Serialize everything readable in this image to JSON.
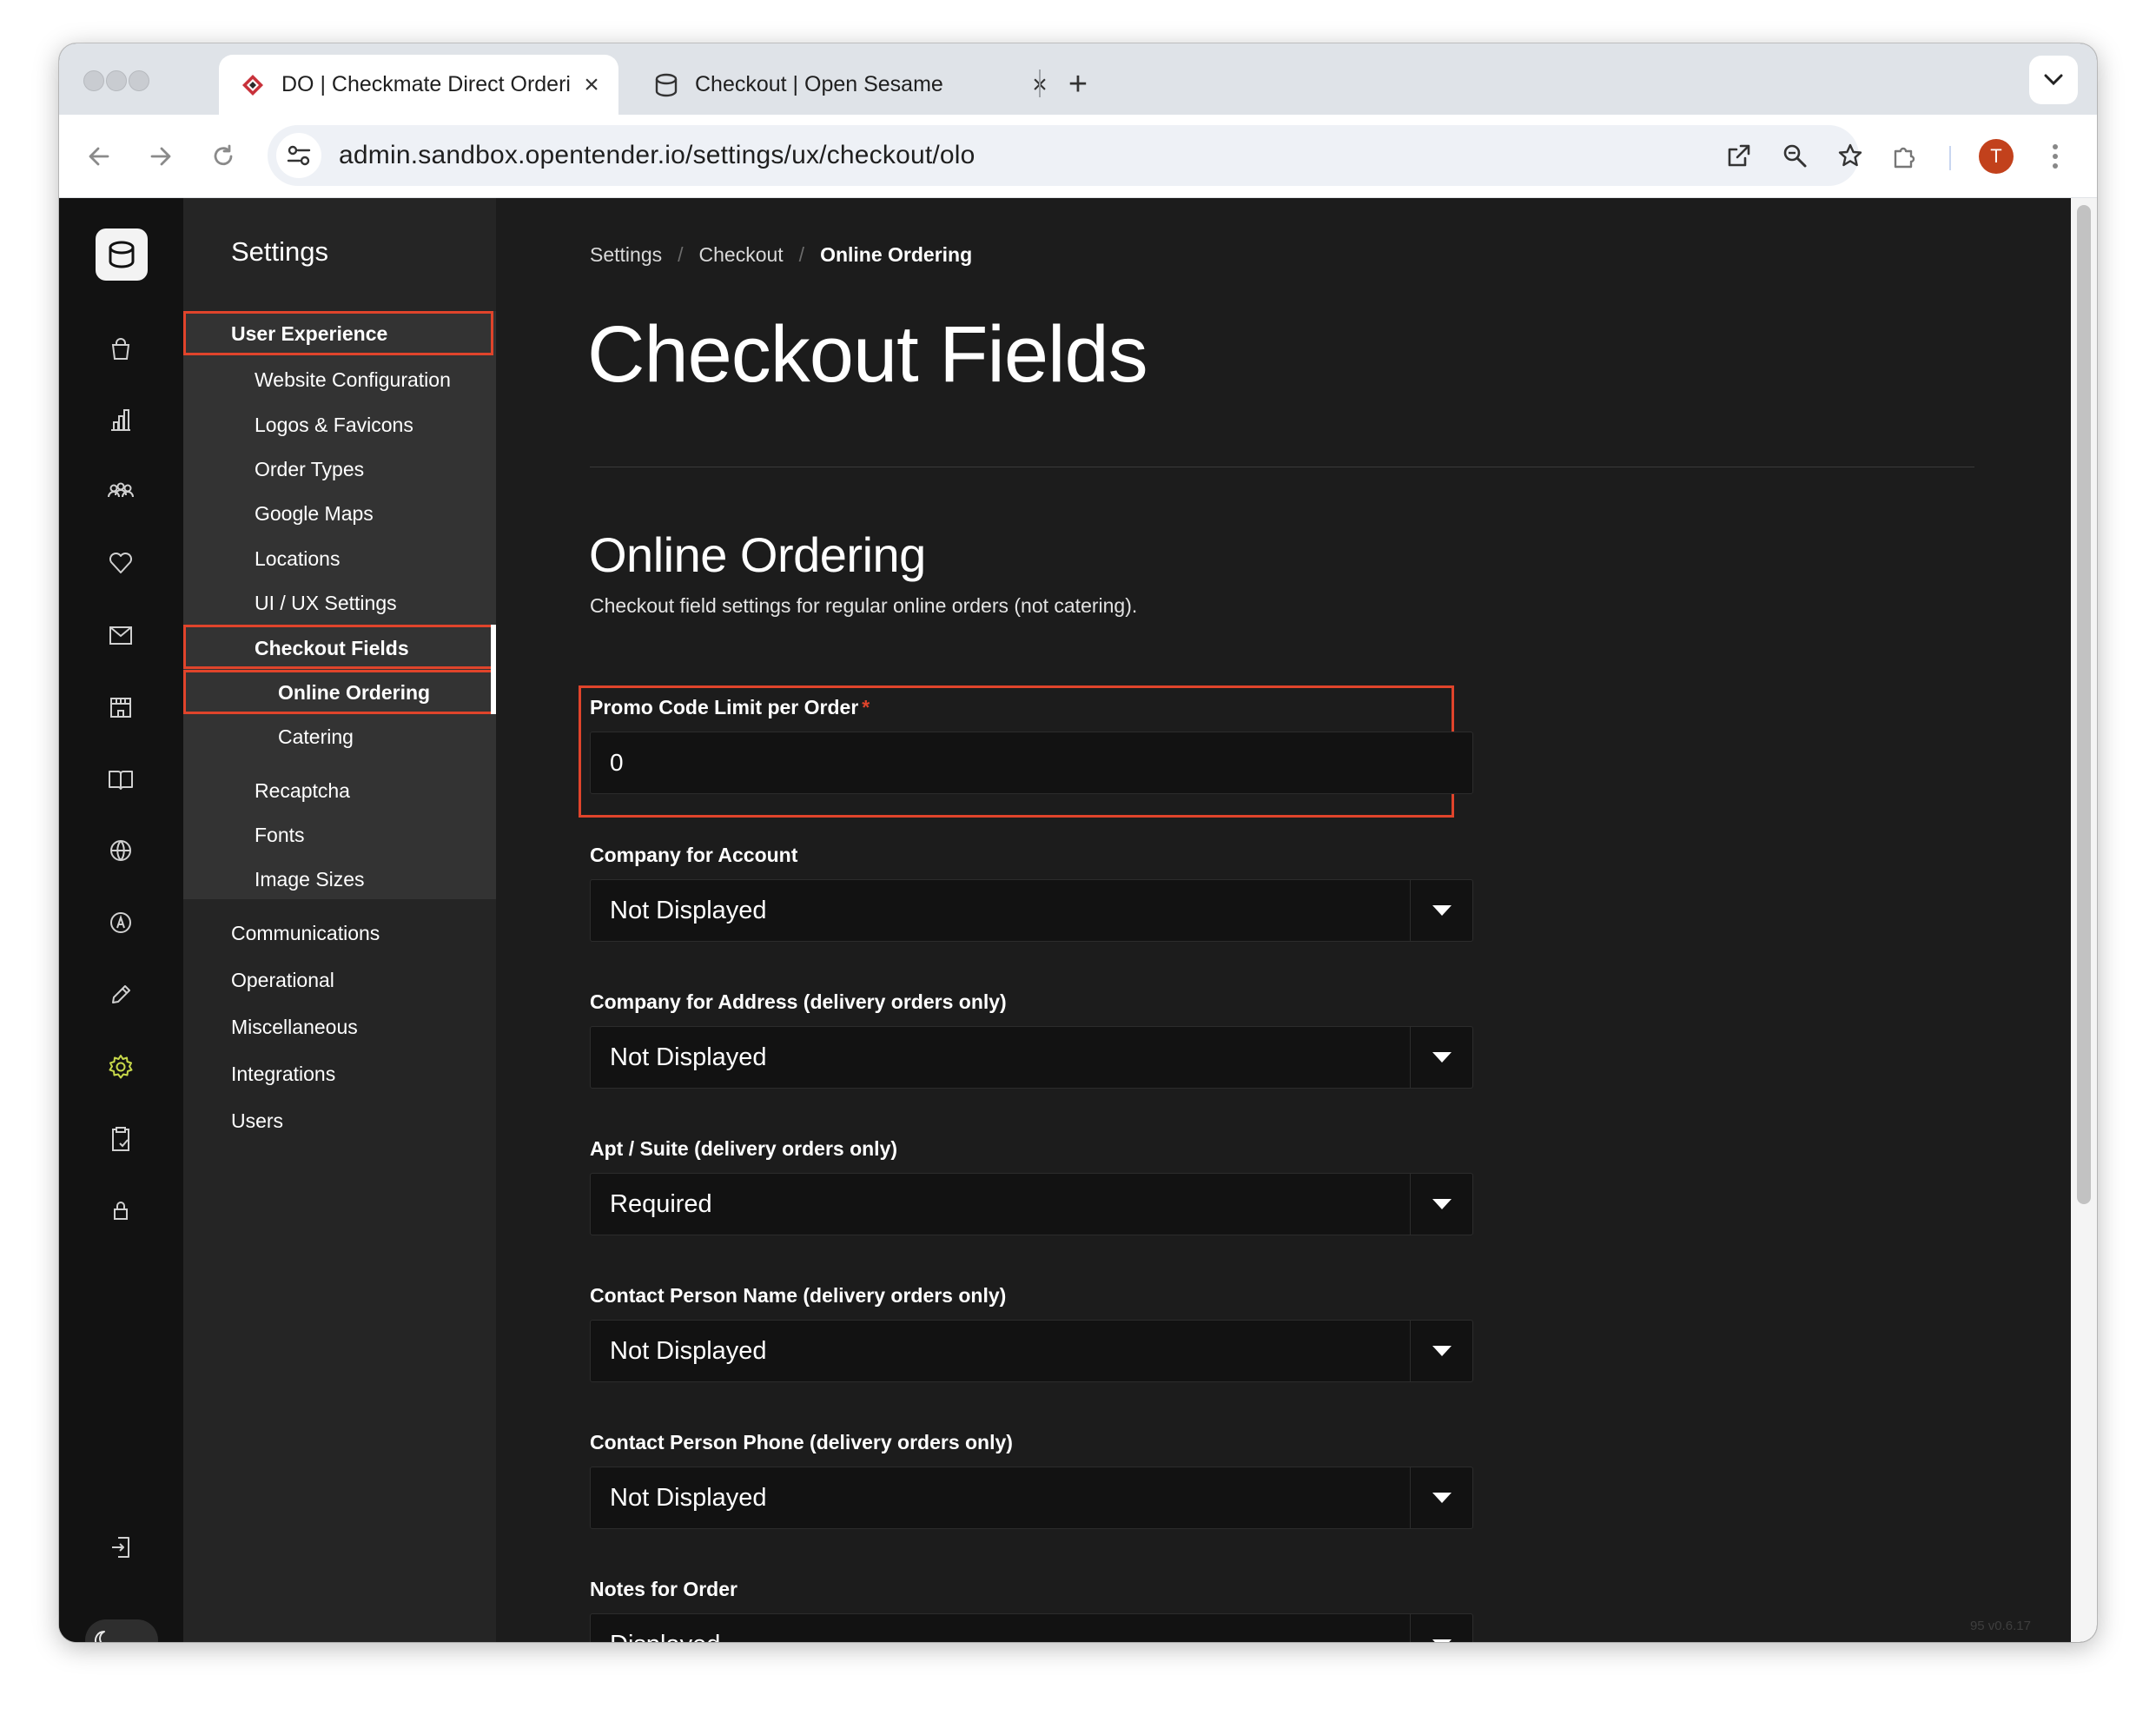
{
  "browser": {
    "tabs": [
      {
        "title": "DO | Checkmate Direct Orderi",
        "active": true
      },
      {
        "title": "Checkout | Open Sesame",
        "active": false
      }
    ],
    "new_tab_label": "+",
    "url": "admin.sandbox.opentender.io/settings/ux/checkout/olo",
    "profile_initial": "T"
  },
  "settings_nav": {
    "title": "Settings",
    "user_experience": "User Experience",
    "ux_items": [
      "Website Configuration",
      "Logos & Favicons",
      "Order Types",
      "Google Maps",
      "Locations",
      "UI / UX Settings"
    ],
    "checkout_fields": "Checkout Fields",
    "checkout_sub": [
      "Online Ordering",
      "Catering"
    ],
    "ux_items_after": [
      "Recaptcha",
      "Fonts",
      "Image Sizes"
    ],
    "top_items": [
      "Communications",
      "Operational",
      "Miscellaneous",
      "Integrations",
      "Users"
    ]
  },
  "breadcrumb": [
    "Settings",
    "Checkout",
    "Online Ordering"
  ],
  "breadcrumb_sep": "/",
  "page": {
    "title": "Checkout Fields",
    "section_title": "Online Ordering",
    "section_subtitle": "Checkout field settings for regular online orders (not catering)."
  },
  "fields": [
    {
      "label": "Promo Code Limit per Order",
      "type": "text",
      "value": "0",
      "required": true
    },
    {
      "label": "Company for Account",
      "type": "select",
      "value": "Not Displayed"
    },
    {
      "label": "Company for Address (delivery orders only)",
      "type": "select",
      "value": "Not Displayed"
    },
    {
      "label": "Apt / Suite (delivery orders only)",
      "type": "select",
      "value": "Required"
    },
    {
      "label": "Contact Person Name (delivery orders only)",
      "type": "select",
      "value": "Not Displayed"
    },
    {
      "label": "Contact Person Phone (delivery orders only)",
      "type": "select",
      "value": "Not Displayed"
    },
    {
      "label": "Notes for Order",
      "type": "select",
      "value": "Displayed"
    }
  ],
  "required_marker": "*",
  "version": "95   v0.6.17",
  "colors": {
    "accent_highlight": "#e0442b",
    "background": "#1c1c1c",
    "rail": "#121212",
    "panel": "#252525"
  }
}
